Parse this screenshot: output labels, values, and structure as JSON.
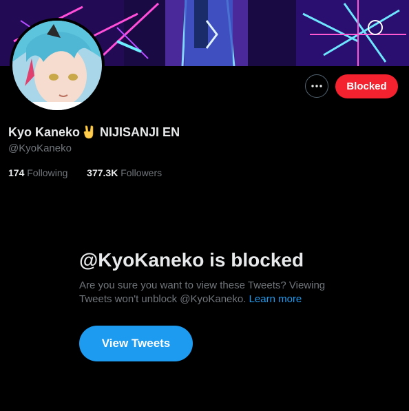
{
  "profile": {
    "display_name": "Kyo Kaneko",
    "name_emoji": "rock-on-hand-emoji",
    "name_suffix": "NIJISANJI EN",
    "handle": "@KyoKaneko",
    "following_count": "174",
    "following_label": "Following",
    "followers_count": "377.3K",
    "followers_label": "Followers"
  },
  "actions": {
    "more_icon": "more-horizontal-icon",
    "blocked_label": "Blocked"
  },
  "blocked_notice": {
    "title": "@KyoKaneko is blocked",
    "description": "Are you sure you want to view these Tweets? Viewing Tweets won't unblock @KyoKaneko.",
    "learn_more": "Learn more",
    "view_button": "View Tweets"
  },
  "colors": {
    "background": "#000000",
    "blocked_red": "#f4212e",
    "accent_blue": "#1d9bf0",
    "secondary_text": "#71767b",
    "primary_text": "#e7e9ea"
  }
}
